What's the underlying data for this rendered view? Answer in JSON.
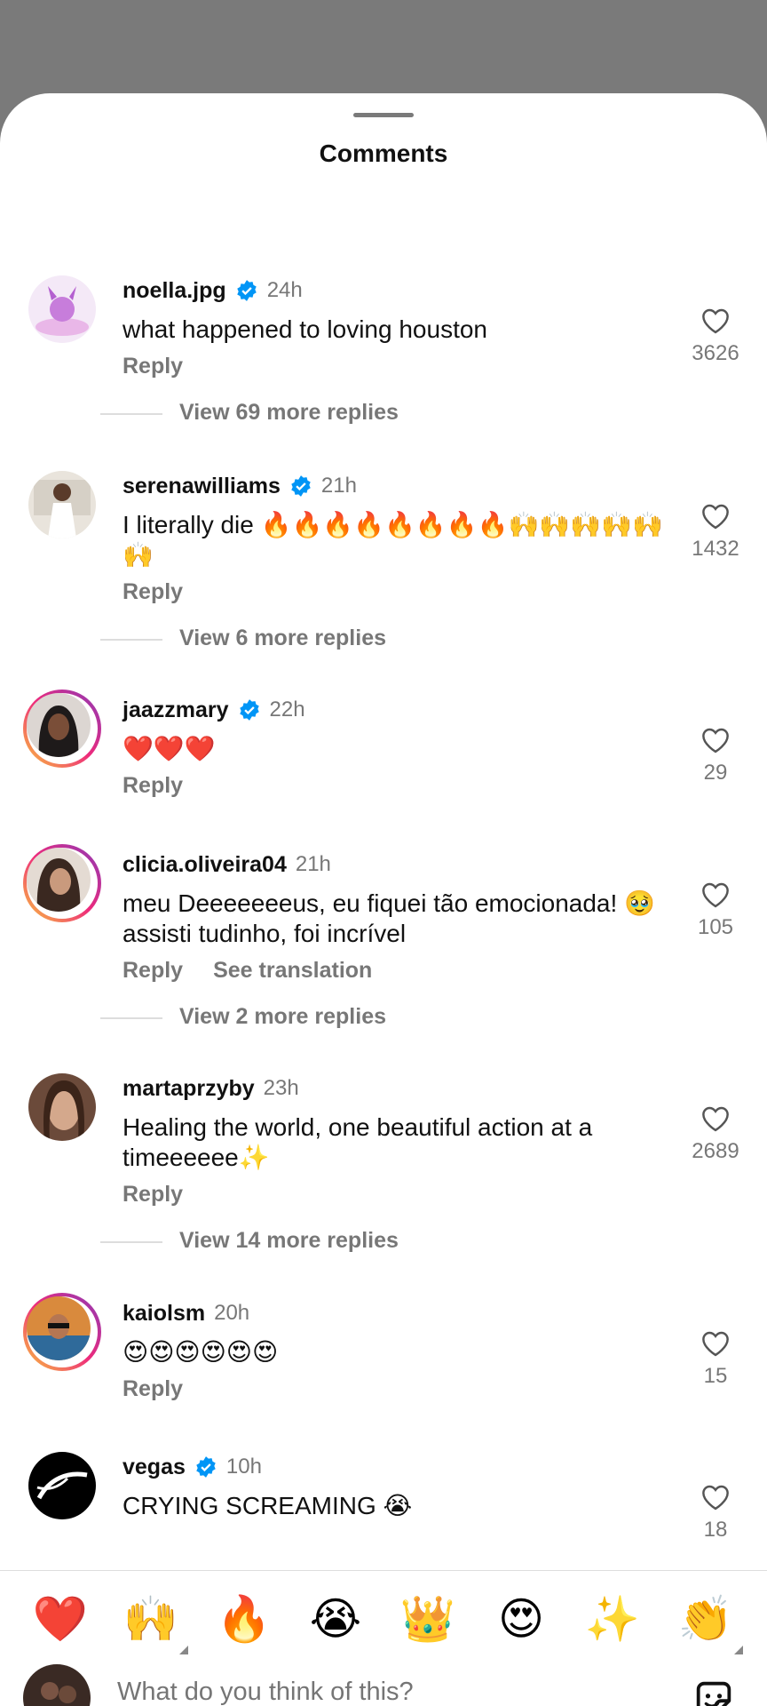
{
  "sheet": {
    "title": "Comments"
  },
  "comments": [
    {
      "username": "noella.jpg",
      "verified": true,
      "time": "24h",
      "text": "what happened to loving houston",
      "reply": "Reply",
      "likes": "3626",
      "view_more": "View 69 more replies"
    },
    {
      "username": "serenawilliams",
      "verified": true,
      "time": "21h",
      "text": "I literally die 🔥🔥🔥🔥🔥🔥🔥🔥🙌🙌🙌🙌🙌🙌",
      "reply": "Reply",
      "likes": "1432",
      "view_more": "View 6 more replies"
    },
    {
      "username": "jaazzmary",
      "verified": true,
      "time": "22h",
      "text": "❤️❤️❤️",
      "reply": "Reply",
      "likes": "29"
    },
    {
      "username": "clicia.oliveira04",
      "verified": false,
      "time": "21h",
      "text": "meu Deeeeeeeus, eu fiquei tão emocionada! 🥹 assisti tudinho, foi incrível",
      "reply": "Reply",
      "see_translation": "See translation",
      "likes": "105",
      "view_more": "View 2 more replies"
    },
    {
      "username": "martaprzyby",
      "verified": false,
      "time": "23h",
      "text": "Healing the world, one beautiful action at a timeeeeee✨",
      "reply": "Reply",
      "likes": "2689",
      "view_more": "View 14 more replies"
    },
    {
      "username": "kaiolsm",
      "verified": false,
      "time": "20h",
      "text": "😍😍😍😍😍😍",
      "reply": "Reply",
      "likes": "15"
    },
    {
      "username": "vegas",
      "verified": true,
      "time": "10h",
      "text": "CRYING SCREAMING 😭",
      "likes": "18"
    }
  ],
  "quick_reactions": [
    "❤️",
    "🙌",
    "🔥",
    "😭",
    "👑",
    "😍",
    "✨",
    "👏"
  ],
  "composer": {
    "placeholder": "What do you think of this?"
  },
  "colors": {
    "verified": "#0095f6",
    "muted": "#777777",
    "story_ring": [
      "#f9c53c",
      "#ee2a7b",
      "#8a3ab9"
    ]
  }
}
